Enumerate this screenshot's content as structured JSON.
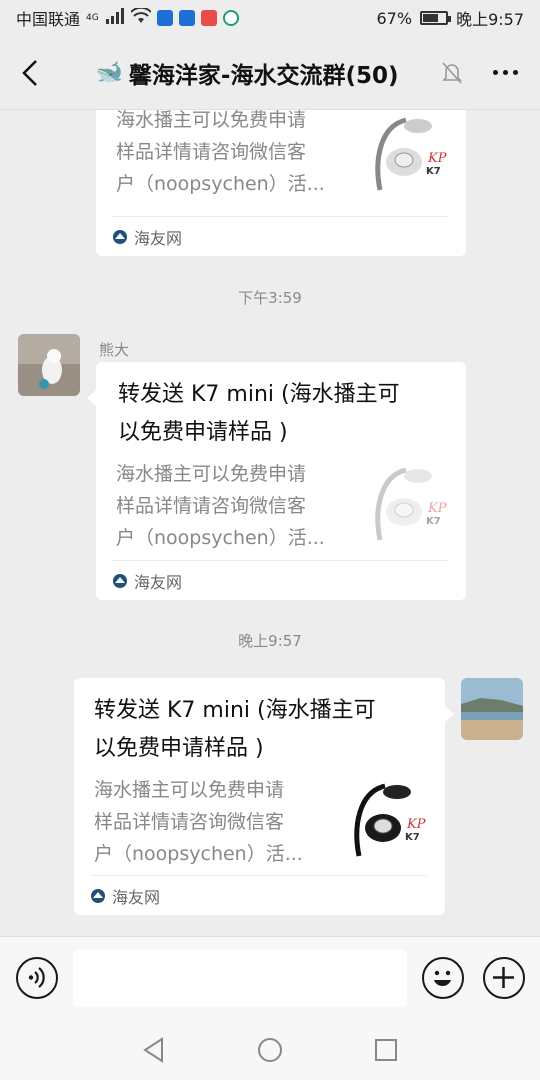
{
  "status_bar": {
    "carrier": "中国联通",
    "network": "4G",
    "battery_percent": "67%",
    "battery_level": 0.67,
    "time": "晚上9:57"
  },
  "nav": {
    "title": "馨海洋家-海水交流群(50)",
    "title_emoji": "🐋"
  },
  "messages": [
    {
      "type": "card_partial",
      "description": "海水播主可以免费申请样品详情请咨询微信客户（noopsychen）活...",
      "desc_lines": [
        "海水播主可以免费申请",
        "样品详情请咨询微信客",
        "户（noopsychen）活..."
      ],
      "source": "海友网"
    },
    {
      "type": "timestamp",
      "text": "下午3:59"
    },
    {
      "type": "card",
      "sender": "熊大",
      "title_lines": [
        "转发送 K7 mini (海水播主可",
        "以免费申请样品 )"
      ],
      "desc_lines": [
        "海水播主可以免费申请",
        "样品详情请咨询微信客",
        "户（noopsychen）活..."
      ],
      "source": "海友网"
    },
    {
      "type": "timestamp",
      "text": "晚上9:57"
    },
    {
      "type": "card",
      "sender": "",
      "title_lines": [
        "转发送 K7 mini (海水播主可",
        "以免费申请样品 )"
      ],
      "desc_lines": [
        "海水播主可以免费申请",
        "样品详情请咨询微信客",
        "户（noopsychen）活..."
      ],
      "source": "海友网"
    }
  ],
  "product": {
    "brand": "K7",
    "brand_suffix": "mini"
  },
  "input": {
    "value": "",
    "placeholder": ""
  },
  "icons": {
    "back": "chevron-left-icon",
    "mute": "bell-off-icon",
    "more": "more-dots-icon",
    "voice": "voice-icon",
    "emoji": "emoji-icon",
    "plus": "plus-icon",
    "sys_back": "triangle-back-icon",
    "sys_home": "circle-home-icon",
    "sys_recent": "square-recent-icon"
  },
  "colors": {
    "background": "#ededed",
    "card": "#ffffff",
    "muted_text": "#888888",
    "source_icon": "#1f4f7a"
  }
}
